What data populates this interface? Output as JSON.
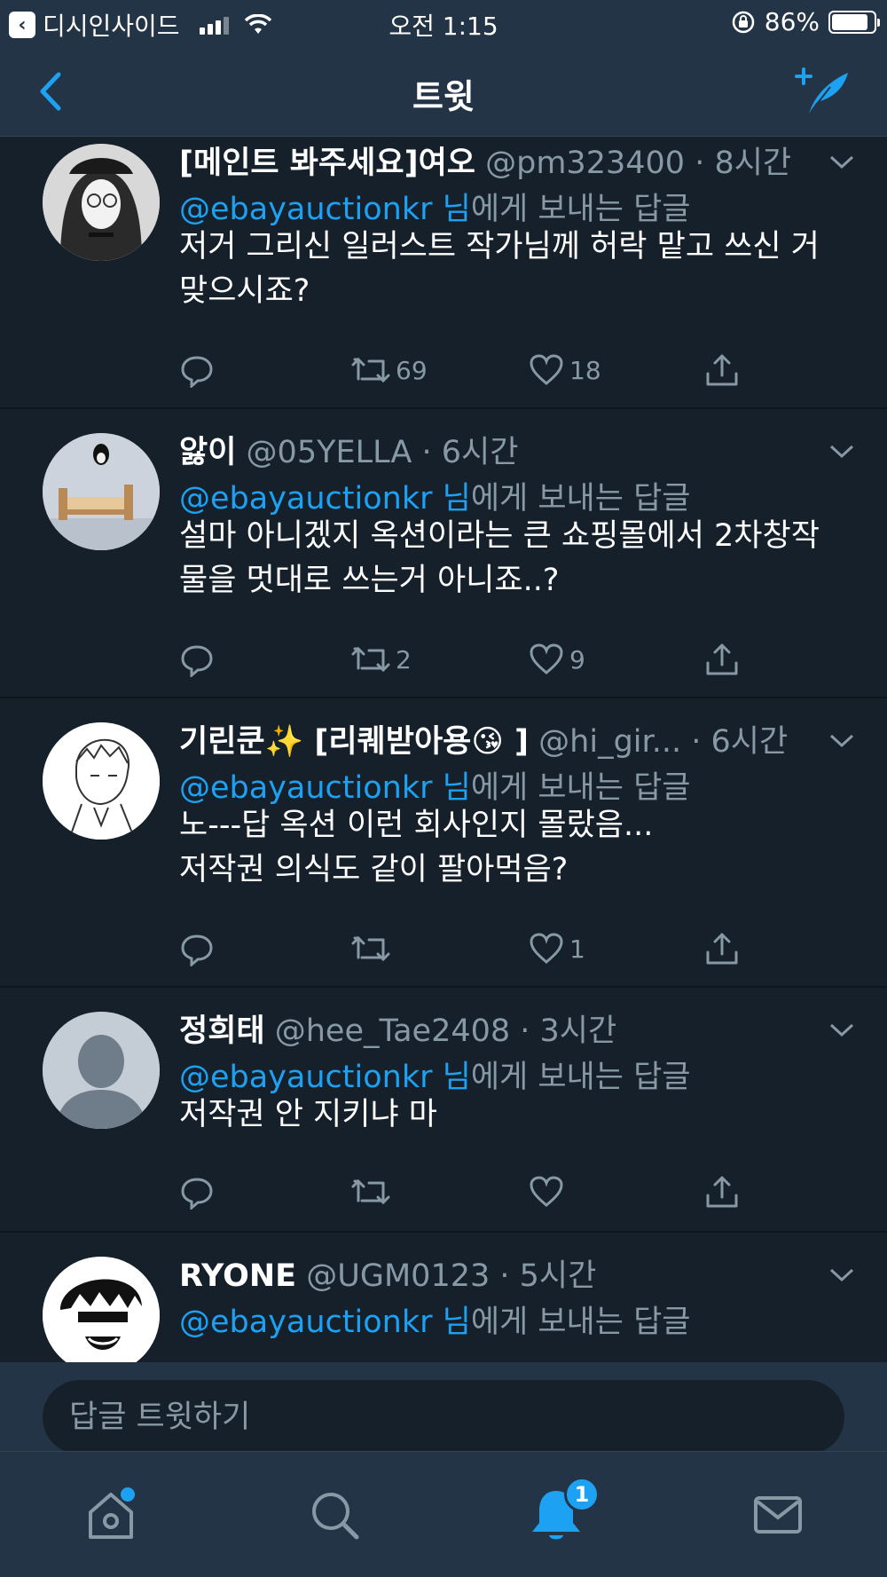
{
  "status_bar": {
    "back_app": "디시인사이드",
    "time": "오전 1:15",
    "battery": "86%",
    "battery_level": 0.86
  },
  "nav": {
    "title": "트윗"
  },
  "tweets": [
    {
      "name": "[메인트 봐주세요]여오",
      "handle": "@pm323400",
      "time": "· 8시간",
      "reply_mention": "@ebayauctionkr 님",
      "reply_suffix": "에게 보내는 답글",
      "text_line1": "저거 그리신 일러스트 작가님께 허락 맡고 쓰신 거",
      "text_line2": "맞으시죠?",
      "retweets": "69",
      "likes": "18"
    },
    {
      "name": "앓이",
      "handle": "@05YELLA",
      "time": "· 6시간",
      "reply_mention": "@ebayauctionkr 님",
      "reply_suffix": "에게 보내는 답글",
      "text_line1": "설마 아니겠지 옥션이라는 큰 쇼핑몰에서 2차창작",
      "text_line2": "물을 멋대로 쓰는거 아니죠..?",
      "retweets": "2",
      "likes": "9"
    },
    {
      "name": "기린쿤✨ [리퀘받아용😘 ]",
      "handle": "@hi_gir...",
      "time": "· 6시간",
      "reply_mention": "@ebayauctionkr 님",
      "reply_suffix": "에게 보내는 답글",
      "text_line1": "노---답 옥션 이런 회사인지 몰랐음...",
      "text_line2": "저작권 의식도 같이 팔아먹음?",
      "retweets": "",
      "likes": "1"
    },
    {
      "name": "정희태",
      "handle": "@hee_Tae2408",
      "time": "· 3시간",
      "reply_mention": "@ebayauctionkr 님",
      "reply_suffix": "에게 보내는 답글",
      "text_line1": "저작권 안 지키냐 마",
      "text_line2": "",
      "retweets": "",
      "likes": ""
    },
    {
      "name": "RYONE",
      "handle": "@UGM0123",
      "time": "· 5시간",
      "reply_mention": "@ebayauctionkr 님",
      "reply_suffix": "에게 보내는 답글",
      "text_line1": "",
      "text_line2": "",
      "retweets": "",
      "likes": ""
    }
  ],
  "reply_bar": {
    "placeholder": "답글 트윗하기"
  },
  "tab_bar": {
    "notification_count": "1"
  },
  "colors": {
    "background": "#15202b",
    "bars": "#243447",
    "accent": "#1da1f2",
    "secondary_text": "#8899a6"
  }
}
